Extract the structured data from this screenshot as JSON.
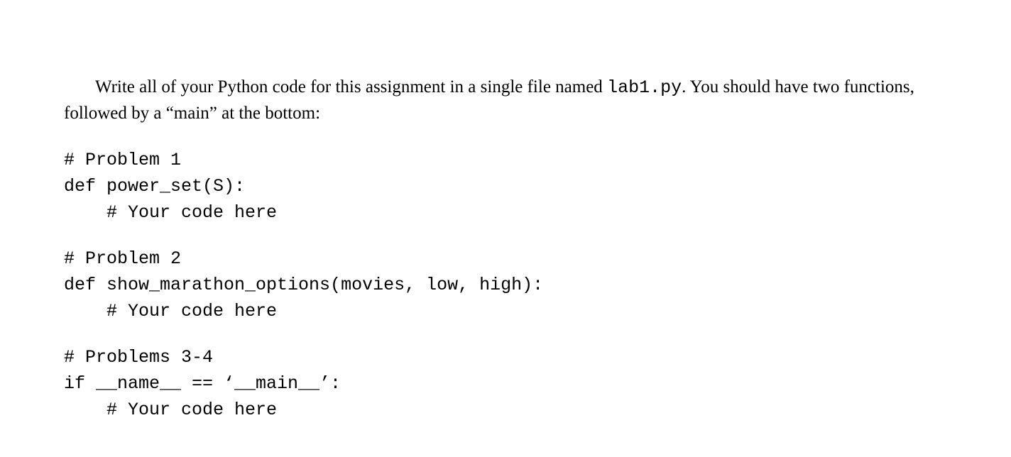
{
  "paragraph": {
    "part1": "Write all of your Python code for this assignment in a single file named ",
    "filename": "lab1.py",
    "part2": ". You should have two functions, followed by a “main” at the bottom:"
  },
  "code": {
    "block1": {
      "l1": "# Problem 1",
      "l2": "def power_set(S):",
      "l3": "    # Your code here"
    },
    "block2": {
      "l1": "# Problem 2",
      "l2": "def show_marathon_options(movies, low, high):",
      "l3": "    # Your code here"
    },
    "block3": {
      "l1": "# Problems 3-4",
      "l2": "if __name__ == ‘__main__’:",
      "l3": "    # Your code here"
    }
  }
}
